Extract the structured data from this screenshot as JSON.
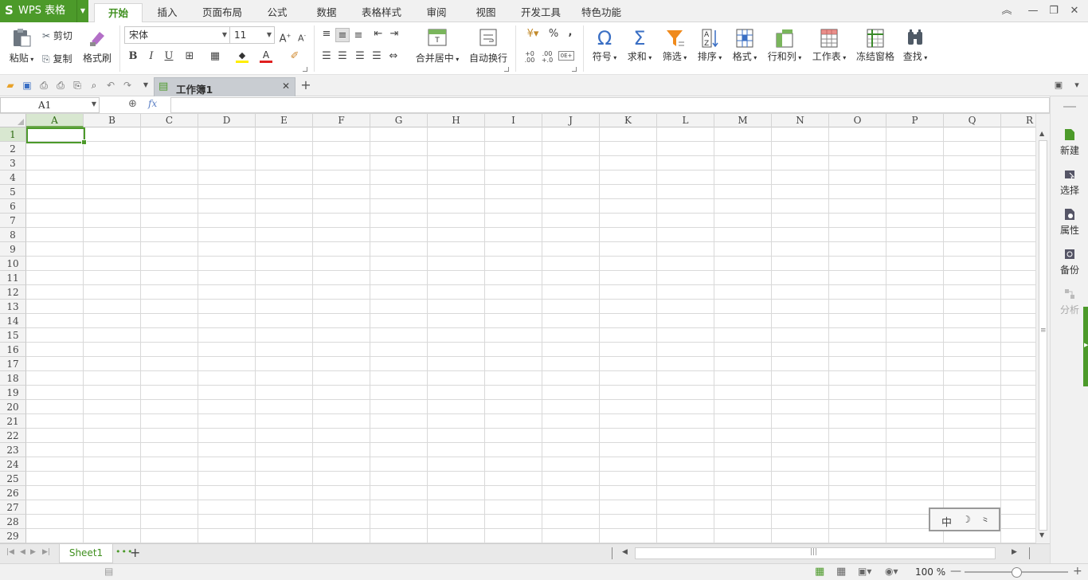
{
  "app": {
    "logo": "S",
    "name": "WPS 表格"
  },
  "tabs": [
    "开始",
    "插入",
    "页面布局",
    "公式",
    "数据",
    "表格样式",
    "审阅",
    "视图",
    "开发工具",
    "特色功能"
  ],
  "window_controls": {
    "ribbon_toggle": "︽",
    "minimize": "—",
    "restore": "❐",
    "close": "✕"
  },
  "ribbon": {
    "paste": "粘贴",
    "cut": "剪切",
    "copy": "复制",
    "format_painter": "格式刷",
    "font_name": "宋体",
    "font_size": "11",
    "bold": "B",
    "italic": "I",
    "underline": "U",
    "merge_center": "合并居中",
    "wrap_text": "自动换行",
    "symbol": "符号",
    "sum": "求和",
    "filter": "筛选",
    "sort": "排序",
    "format": "格式",
    "row_col": "行和列",
    "worksheet": "工作表",
    "freeze": "冻结窗格",
    "find": "查找",
    "percent": "%",
    "comma": ","
  },
  "document": {
    "tab_title": "工作簿1"
  },
  "formula_bar": {
    "name_box": "A1",
    "fx": "fx",
    "formula": ""
  },
  "grid": {
    "columns": [
      "A",
      "B",
      "C",
      "D",
      "E",
      "F",
      "G",
      "H",
      "I",
      "J",
      "K",
      "L",
      "M",
      "N",
      "O",
      "P",
      "Q",
      "R"
    ],
    "rows": [
      "1",
      "2",
      "3",
      "4",
      "5",
      "6",
      "7",
      "8",
      "9",
      "10",
      "11",
      "12",
      "13",
      "14",
      "15",
      "16",
      "17",
      "18",
      "19",
      "20",
      "21",
      "22",
      "23",
      "24",
      "25",
      "26",
      "27",
      "28",
      "29"
    ],
    "selected_cell": "A1"
  },
  "right_panel": [
    "新建",
    "选择",
    "属性",
    "备份",
    "分析"
  ],
  "ime_badge": [
    "中",
    "☽",
    "⺀"
  ],
  "sheets": [
    "Sheet1"
  ],
  "status": {
    "zoom": "100 %"
  },
  "colors": {
    "accent": "#4c9a2a",
    "tab_active_text": "#3f8f1e",
    "selection_header": "#d8e7d0"
  }
}
